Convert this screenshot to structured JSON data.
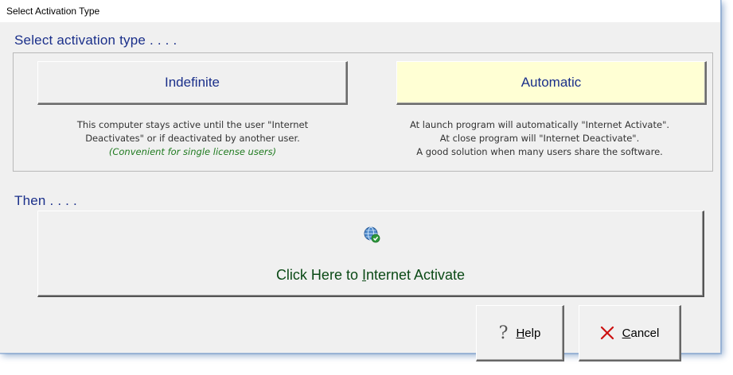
{
  "window": {
    "title": "Select Activation Type"
  },
  "section1": {
    "heading": "Select activation type . . . ."
  },
  "indefinite": {
    "label": "Indefinite",
    "desc_line1": "This computer stays active until the user \"Internet",
    "desc_line2": "Deactivates\" or if deactivated by another user.",
    "note": "(Convenient for single license users)"
  },
  "automatic": {
    "label": "Automatic",
    "desc_line1": "At launch program will automatically \"Internet Activate\".",
    "desc_line2": "At close program will \"Internet Deactivate\".",
    "desc_line3": "A good solution when many users share the software."
  },
  "section2": {
    "heading": "Then . . . ."
  },
  "activate": {
    "label_pre": "Click Here to ",
    "label_hotkey": "I",
    "label_post": "nternet Activate",
    "icon": "globe-check-icon"
  },
  "help_button": {
    "hotkey": "H",
    "rest": "elp",
    "icon": "question-icon"
  },
  "cancel_button": {
    "hotkey": "C",
    "rest": "ancel",
    "icon": "x-icon"
  },
  "colors": {
    "heading": "#1a2f8a",
    "automatic_bg": "#ffffd4",
    "note": "#1f7a1f",
    "activate_text": "#0b4a16",
    "cancel_x": "#cc1111"
  }
}
